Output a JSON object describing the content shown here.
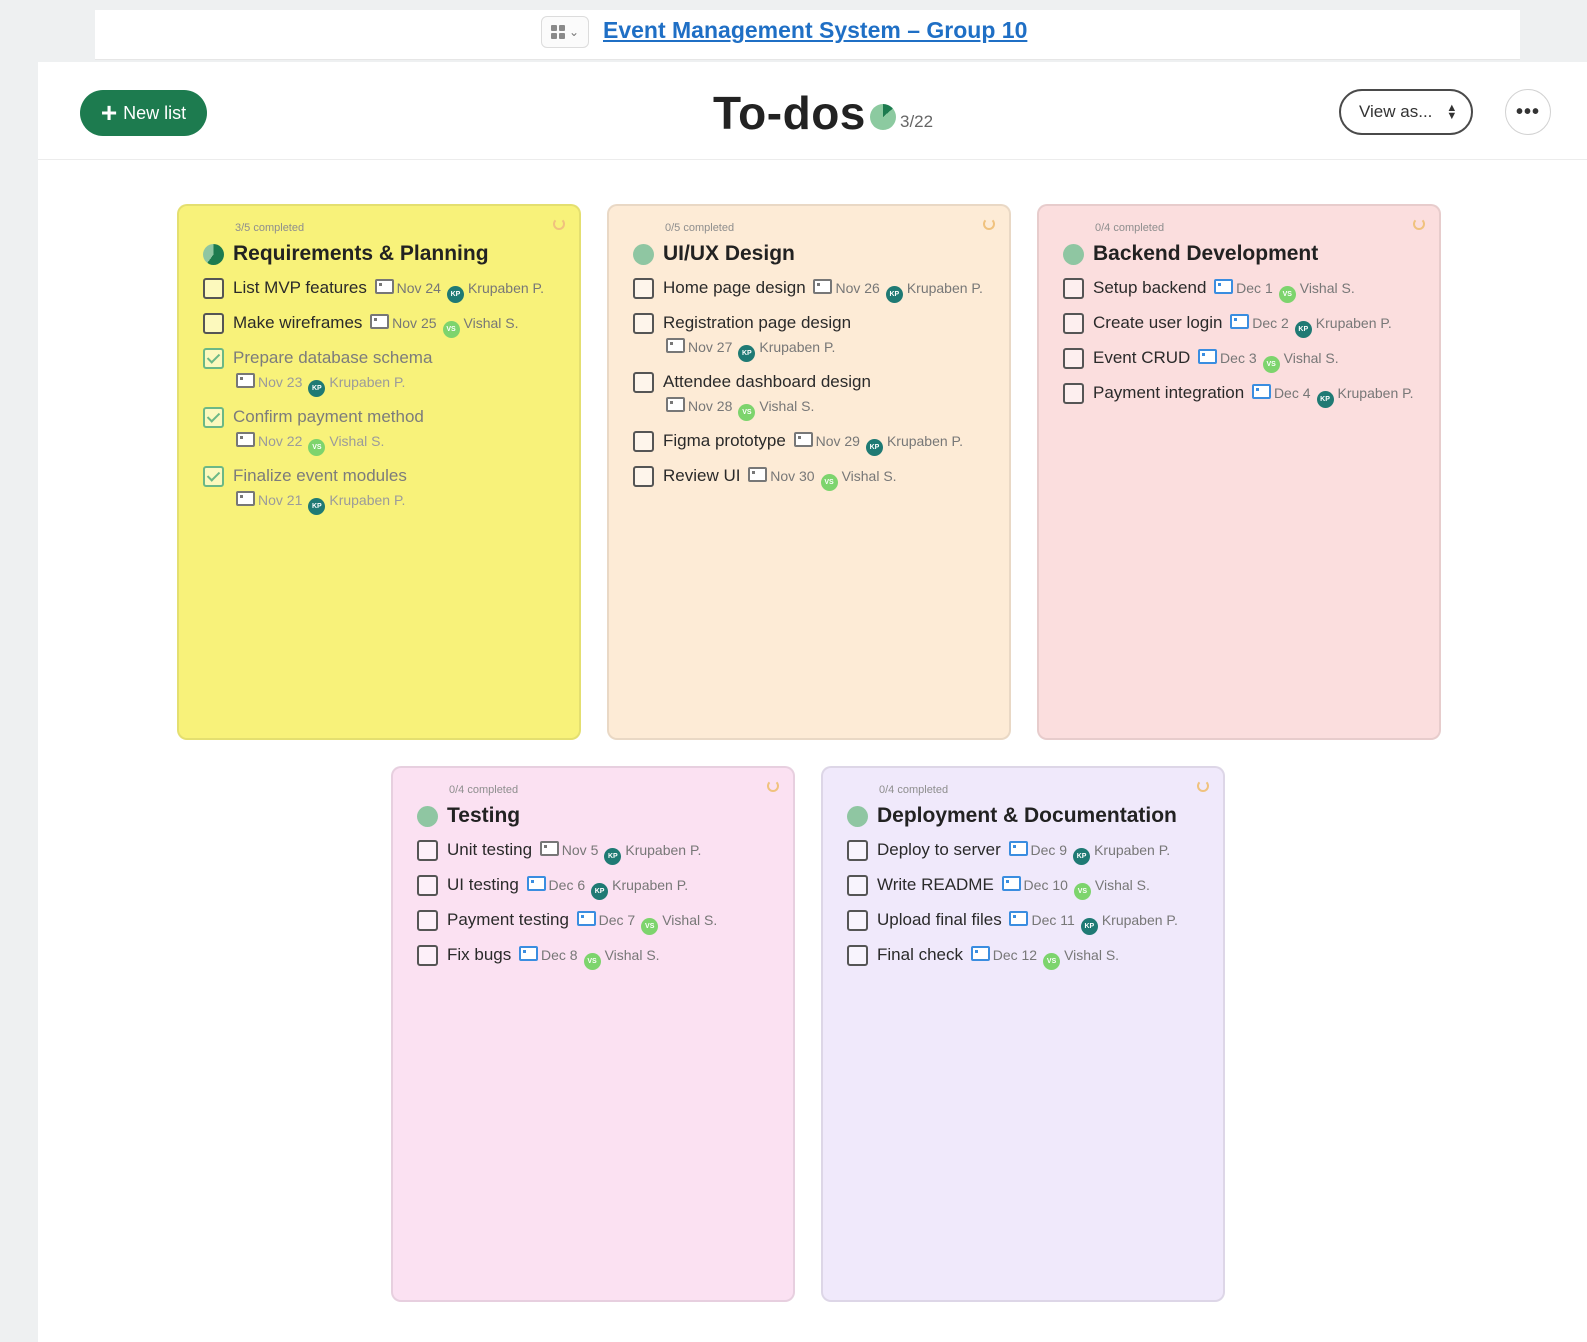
{
  "project": {
    "title": "Event Management System – Group 10"
  },
  "header": {
    "new_list_label": "New list",
    "page_title": "To-dos",
    "progress_count": "3/22",
    "progress_fraction": 0.136,
    "view_as_label": "View as...",
    "more_label": "•••"
  },
  "colors": {
    "accent_green": "#1d7b4f",
    "link_blue": "#1f6fc5",
    "card_yellow": "#f8f27a",
    "card_peach": "#fdebd6",
    "card_pink": "#fbdede",
    "card_magenta": "#fbe1f2",
    "card_lavender": "#f0e9fb"
  },
  "lists": [
    {
      "completed_label": "3/5 completed",
      "title": "Requirements & Planning",
      "progress_fraction": 0.6,
      "tasks": [
        {
          "name": "List MVP features",
          "date": "Nov 24",
          "assignee": "Krupaben P.",
          "initials": "KP",
          "done": false
        },
        {
          "name": "Make wireframes",
          "date": "Nov 25",
          "assignee": "Vishal S.",
          "initials": "VS",
          "done": false
        },
        {
          "name": "Prepare database schema",
          "date": "Nov 23",
          "assignee": "Krupaben P.",
          "initials": "KP",
          "done": true
        },
        {
          "name": "Confirm payment method",
          "date": "Nov 22",
          "assignee": "Vishal S.",
          "initials": "VS",
          "done": true
        },
        {
          "name": "Finalize event modules",
          "date": "Nov 21",
          "assignee": "Krupaben P.",
          "initials": "KP",
          "done": true
        }
      ]
    },
    {
      "completed_label": "0/5 completed",
      "title": "UI/UX Design",
      "progress_fraction": 0,
      "tasks": [
        {
          "name": "Home page design",
          "date": "Nov 26",
          "assignee": "Krupaben P.",
          "initials": "KP",
          "done": false
        },
        {
          "name": "Registration page design",
          "date": "Nov 27",
          "assignee": "Krupaben P.",
          "initials": "KP",
          "done": false
        },
        {
          "name": "Attendee dashboard design",
          "date": "Nov 28",
          "assignee": "Vishal S.",
          "initials": "VS",
          "done": false
        },
        {
          "name": "Figma prototype",
          "date": "Nov 29",
          "assignee": "Krupaben P.",
          "initials": "KP",
          "done": false
        },
        {
          "name": "Review UI",
          "date": "Nov 30",
          "assignee": "Vishal S.",
          "initials": "VS",
          "done": false
        }
      ]
    },
    {
      "completed_label": "0/4 completed",
      "title": "Backend Development",
      "progress_fraction": 0,
      "tasks": [
        {
          "name": "Setup backend",
          "date": "Dec 1",
          "assignee": "Vishal S.",
          "initials": "VS",
          "done": false
        },
        {
          "name": "Create user login",
          "date": "Dec 2",
          "assignee": "Krupaben P.",
          "initials": "KP",
          "done": false
        },
        {
          "name": "Event CRUD",
          "date": "Dec 3",
          "assignee": "Vishal S.",
          "initials": "VS",
          "done": false
        },
        {
          "name": "Payment integration",
          "date": "Dec 4",
          "assignee": "Krupaben P.",
          "initials": "KP",
          "done": false
        }
      ]
    },
    {
      "completed_label": "0/4 completed",
      "title": "Testing",
      "progress_fraction": 0,
      "tasks": [
        {
          "name": "Unit testing",
          "date": "Nov 5",
          "assignee": "Krupaben P.",
          "initials": "KP",
          "done": false
        },
        {
          "name": "UI testing",
          "date": "Dec 6",
          "assignee": "Krupaben P.",
          "initials": "KP",
          "done": false
        },
        {
          "name": "Payment testing",
          "date": "Dec 7",
          "assignee": "Vishal S.",
          "initials": "VS",
          "done": false
        },
        {
          "name": "Fix bugs",
          "date": "Dec 8",
          "assignee": "Vishal S.",
          "initials": "VS",
          "done": false
        }
      ]
    },
    {
      "completed_label": "0/4 completed",
      "title": "Deployment & Documentation",
      "progress_fraction": 0,
      "tasks": [
        {
          "name": "Deploy to server",
          "date": "Dec 9",
          "assignee": "Krupaben P.",
          "initials": "KP",
          "done": false
        },
        {
          "name": "Write README",
          "date": "Dec 10",
          "assignee": "Vishal S.",
          "initials": "VS",
          "done": false
        },
        {
          "name": "Upload final files",
          "date": "Dec 11",
          "assignee": "Krupaben P.",
          "initials": "KP",
          "done": false
        },
        {
          "name": "Final check",
          "date": "Dec 12",
          "assignee": "Vishal S.",
          "initials": "VS",
          "done": false
        }
      ]
    }
  ]
}
